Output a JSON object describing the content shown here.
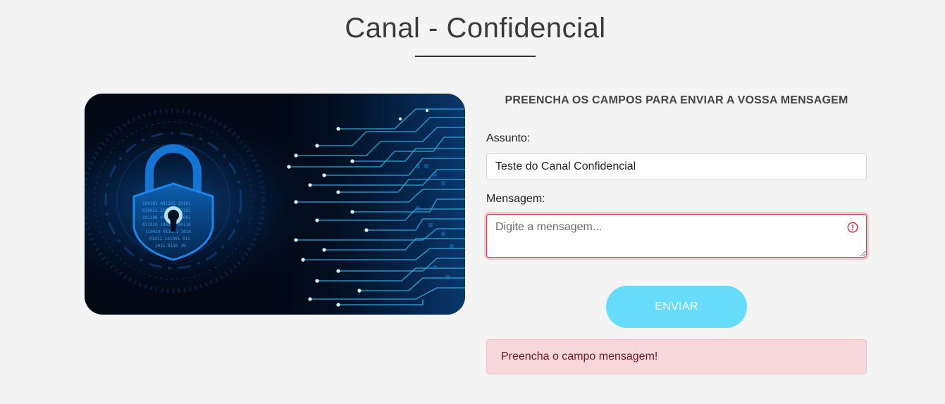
{
  "page": {
    "title": "Canal - Confidencial"
  },
  "hero": {
    "icon": "padlock-circuit-illustration"
  },
  "form": {
    "heading": "PREENCHA OS CAMPOS PARA ENVIAR A VOSSA MENSAGEM",
    "subject_label": "Assunto:",
    "subject_value": "Teste do Canal Confidencial",
    "message_label": "Mensagem:",
    "message_value": "",
    "message_placeholder": "Digite a mensagem...",
    "message_state": "invalid",
    "submit_label": "ENVIAR"
  },
  "alert": {
    "message": "Preencha o campo mensagem!"
  },
  "colors": {
    "background": "#f4f4f4",
    "button": "#67dcfa",
    "error": "#dc3545",
    "alert_background": "#f8d7da",
    "alert_text": "#6b1a22"
  }
}
